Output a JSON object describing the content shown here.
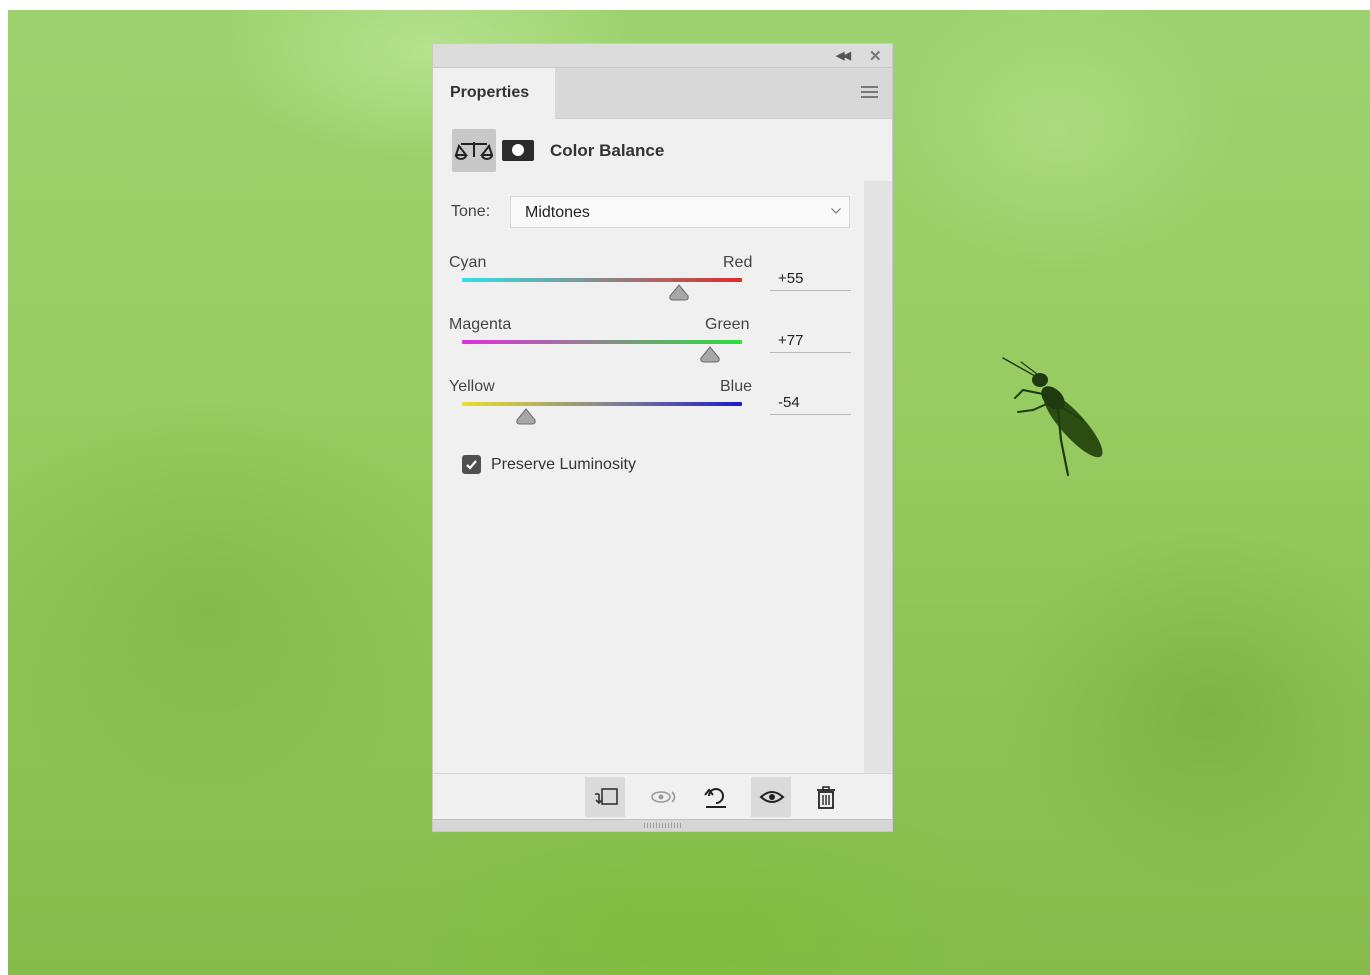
{
  "panel": {
    "tab_label": "Properties",
    "adjustment_title": "Color Balance",
    "tone": {
      "label": "Tone:",
      "selected": "Midtones"
    },
    "sliders": [
      {
        "left_label": "Cyan",
        "right_label": "Red",
        "value": "+55",
        "level": 0.775,
        "gradient": [
          "#2fe0e6",
          "#e02a2a"
        ]
      },
      {
        "left_label": "Magenta",
        "right_label": "Green",
        "value": "+77",
        "level": 0.885,
        "gradient": [
          "#e22ce0",
          "#2ae03a"
        ]
      },
      {
        "left_label": "Yellow",
        "right_label": "Blue",
        "value": "-54",
        "level": 0.23,
        "gradient": [
          "#e8e02a",
          "#1a1ad0"
        ]
      }
    ],
    "preserve_luminosity": {
      "label": "Preserve Luminosity",
      "checked": true
    },
    "footer_icons": [
      "clip-to-layer-icon",
      "view-previous-state-icon",
      "reset-icon",
      "visibility-eye-icon",
      "delete-icon"
    ]
  },
  "colors": {
    "panel_bg": "#f0f0f0",
    "canvas_green": "#97cc62"
  }
}
